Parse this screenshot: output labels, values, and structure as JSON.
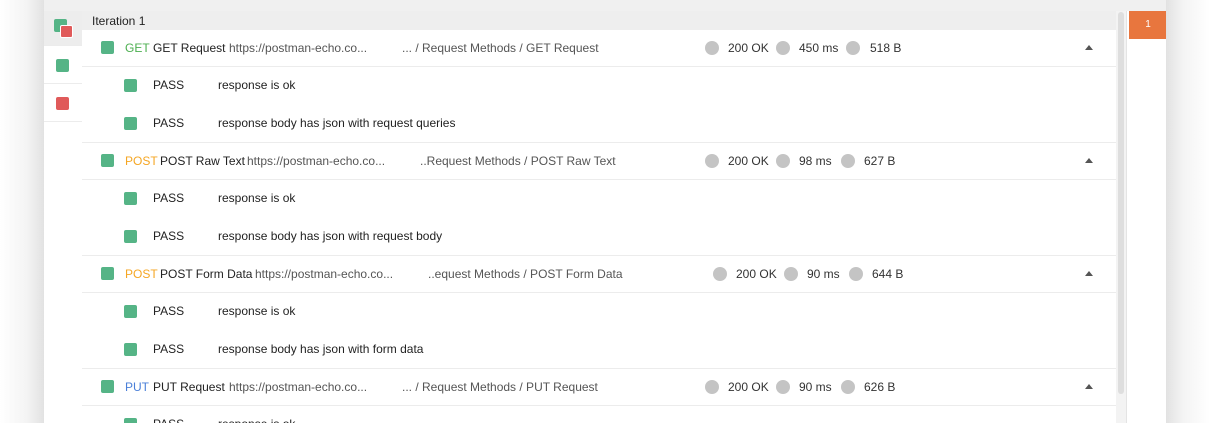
{
  "iteration": {
    "title": "Iteration 1"
  },
  "side_panel": {
    "iteration_tab": "1"
  },
  "filters": [
    {
      "name": "all",
      "colors": [
        "#55b486",
        "#e05a5a"
      ]
    },
    {
      "name": "passed",
      "color": "#55b486"
    },
    {
      "name": "failed",
      "color": "#e05a5a"
    }
  ],
  "colors": {
    "pass": "#55b486",
    "fail": "#e05a5a",
    "get": "#4caf50",
    "post": "#f5a623",
    "put": "#4a7fd8",
    "accent": "#e8763e"
  },
  "requests": [
    {
      "method": "GET",
      "name": "GET Request",
      "url": "https://postman-echo.co...",
      "path": "... / Request Methods / GET Request",
      "status": "200 OK",
      "time": "450 ms",
      "size": "518 B",
      "tests": [
        {
          "result": "PASS",
          "name": "response is ok"
        },
        {
          "result": "PASS",
          "name": "response body has json with request queries"
        }
      ]
    },
    {
      "method": "POST",
      "name": "POST Raw Text",
      "url": "https://postman-echo.co...",
      "path": "..Request Methods / POST Raw Text",
      "status": "200 OK",
      "time": "98 ms",
      "size": "627 B",
      "tests": [
        {
          "result": "PASS",
          "name": "response is ok"
        },
        {
          "result": "PASS",
          "name": "response body has json with request body"
        }
      ]
    },
    {
      "method": "POST",
      "name": "POST Form Data",
      "url": "https://postman-echo.co...",
      "path": "..equest Methods / POST Form Data",
      "status": "200 OK",
      "time": "90 ms",
      "size": "644 B",
      "tests": [
        {
          "result": "PASS",
          "name": "response is ok"
        },
        {
          "result": "PASS",
          "name": "response body has json with form data"
        }
      ]
    },
    {
      "method": "PUT",
      "name": "PUT Request",
      "url": "https://postman-echo.co...",
      "path": "... / Request Methods / PUT Request",
      "status": "200 OK",
      "time": "90 ms",
      "size": "626 B",
      "tests": [
        {
          "result": "PASS",
          "name": "response is ok"
        }
      ]
    }
  ]
}
